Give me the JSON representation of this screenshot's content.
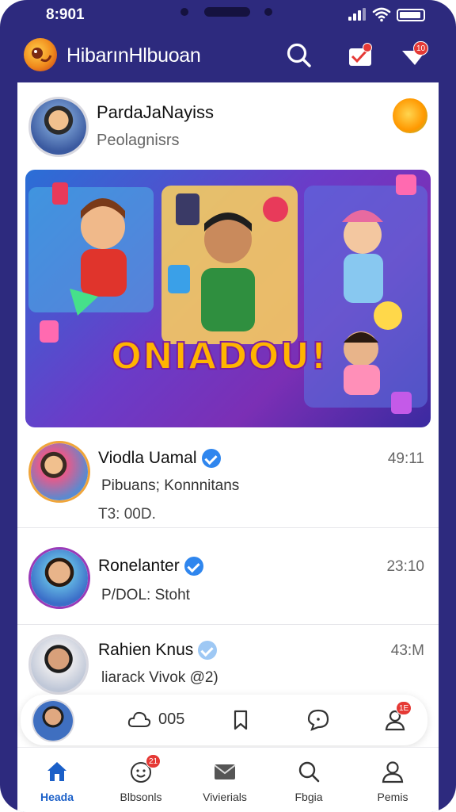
{
  "status": {
    "time": "8:901"
  },
  "app": {
    "title": "HibarınHlbuoan",
    "notification_badge": "",
    "heart_badge": "10"
  },
  "post": {
    "author": "PardaJaNayiss",
    "subtitle": "Peolagnisrs",
    "banner_text": "ONIADOU!"
  },
  "chats": [
    {
      "name": "Viodla Uamal",
      "verified": true,
      "time": "49:11",
      "message": "Pibuans; Konnnitans",
      "extra": "T3: 00D."
    },
    {
      "name": "Ronelanter",
      "verified": true,
      "time": "23:10",
      "message": "P/DOL: Stoht"
    },
    {
      "name": "Rahien Knus",
      "verified": true,
      "time": "43:M",
      "message": "liarack Vivok @2)"
    }
  ],
  "dock": {
    "count_label": "005",
    "alert_badge": "1E"
  },
  "tabs": [
    {
      "label": "Heada",
      "badge": ""
    },
    {
      "label": "Blbsonls",
      "badge": "21"
    },
    {
      "label": "Vivierials",
      "badge": ""
    },
    {
      "label": "Fbgia",
      "badge": ""
    },
    {
      "label": "Pemis",
      "badge": ""
    }
  ],
  "colors": {
    "frame": "#2d2a7e",
    "accent": "#1a5fc8",
    "verified": "#2f86ee",
    "badge": "#e53935"
  }
}
